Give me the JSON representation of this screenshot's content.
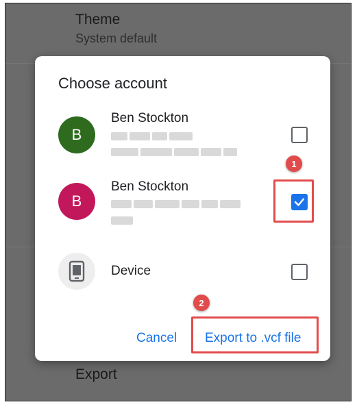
{
  "background": {
    "theme_title": "Theme",
    "theme_value": "System default",
    "export_title": "Export"
  },
  "dialog": {
    "title": "Choose account",
    "accounts": [
      {
        "initial": "B",
        "name": "Ben Stockton",
        "color": "#2e6b1f",
        "checked": false
      },
      {
        "initial": "B",
        "name": "Ben Stockton",
        "color": "#c2185b",
        "checked": true
      }
    ],
    "device": {
      "name": "Device",
      "checked": false
    },
    "cancel_label": "Cancel",
    "export_label": "Export to .vcf file"
  },
  "annotations": {
    "badge_1": "1",
    "badge_2": "2",
    "highlight_color": "#e24b4b"
  },
  "accent_color": "#1a73e8"
}
